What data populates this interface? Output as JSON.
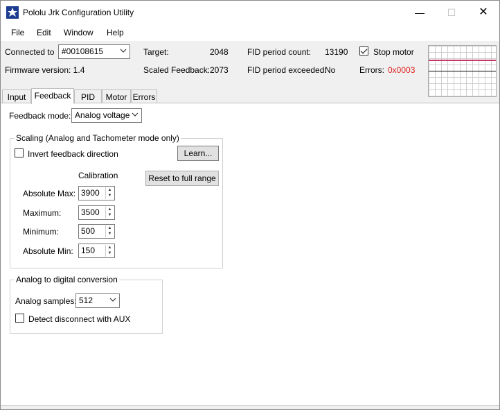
{
  "window": {
    "title": "Pololu Jrk Configuration Utility",
    "minimize": "—",
    "maximize": "☐",
    "close": "✕"
  },
  "menu": {
    "items": [
      "File",
      "Edit",
      "Window",
      "Help"
    ]
  },
  "header": {
    "connected_label": "Connected to",
    "device_value": "#00108615",
    "firmware_label": "Firmware version: 1.4",
    "target_label": "Target:",
    "target_value": "2048",
    "scaled_feedback_label": "Scaled Feedback:",
    "scaled_feedback_value": "2073",
    "fid_count_label": "FID period count:",
    "fid_count_value": "13190",
    "fid_exceeded_label": "FID period exceeded:",
    "fid_exceeded_value": "No",
    "stop_motor_label": "Stop motor",
    "stop_motor_checked": true,
    "errors_label": "Errors:",
    "errors_value": "0x0003",
    "errors_color": "#e02020"
  },
  "tabs": [
    {
      "label": "Input",
      "active": false
    },
    {
      "label": "Feedback",
      "active": true
    },
    {
      "label": "PID",
      "active": false
    },
    {
      "label": "Motor",
      "active": false
    },
    {
      "label": "Errors",
      "active": false
    }
  ],
  "feedback": {
    "mode_label": "Feedback mode:",
    "mode_value": "Analog voltage",
    "scaling": {
      "legend": "Scaling (Analog and Tachometer mode only)",
      "invert_label": "Invert feedback direction",
      "invert_checked": false,
      "learn_button": "Learn...",
      "reset_button": "Reset to full range",
      "calibration_label": "Calibration",
      "absolute_max_label": "Absolute Max:",
      "absolute_max_value": "3900",
      "maximum_label": "Maximum:",
      "maximum_value": "3500",
      "minimum_label": "Minimum:",
      "minimum_value": "500",
      "absolute_min_label": "Absolute Min:",
      "absolute_min_value": "150"
    },
    "adc": {
      "legend": "Analog to digital conversion",
      "samples_label": "Analog samples:",
      "samples_value": "512",
      "detect_label": "Detect disconnect with AUX",
      "detect_checked": false
    }
  },
  "colors": {
    "target_line": "#c33a6a",
    "feedback_line": "#000000",
    "app_icon": "#1d3c8f"
  }
}
